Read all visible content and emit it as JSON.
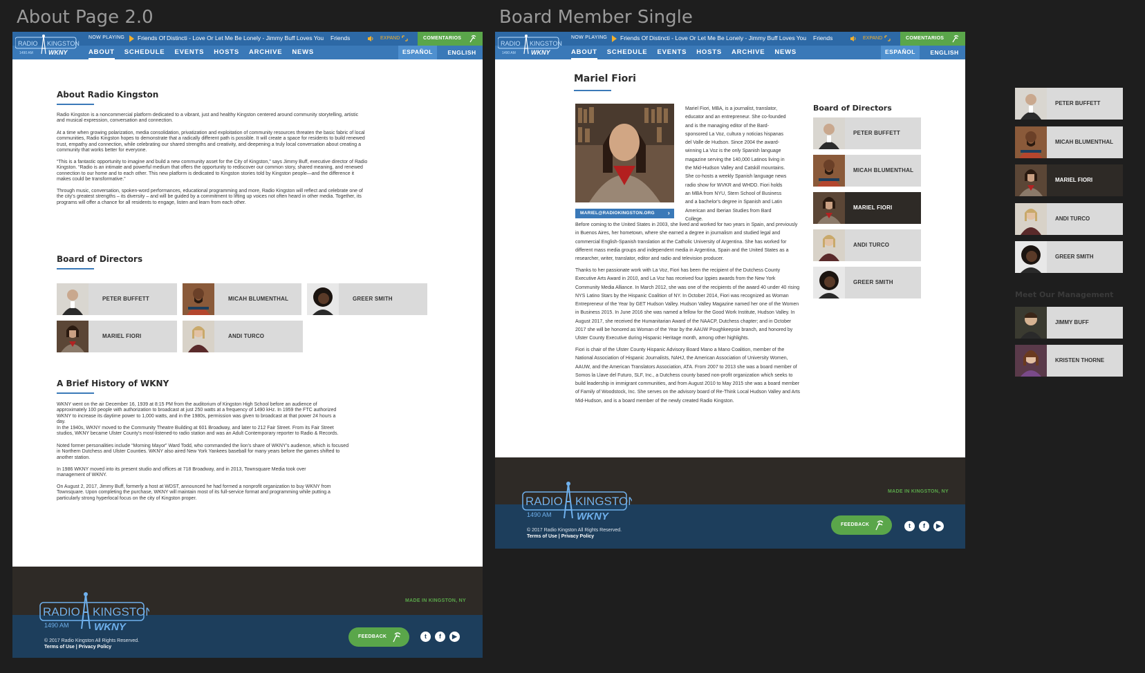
{
  "frames": {
    "about_title": "About Page 2.0",
    "single_title": "Board Member Single"
  },
  "header": {
    "now_playing_label": "NOW PLAYING",
    "track": "Friends Of Distincti - Love Or Let Me Be Lonely - Jimmy Buff Loves You",
    "track_extra": "Friends",
    "expand_label": "EXPAND",
    "comentarios_label": "COMENTARIOS",
    "nav": [
      "ABOUT",
      "SCHEDULE",
      "EVENTS",
      "HOSTS",
      "ARCHIVE",
      "NEWS"
    ],
    "lang_es": "ESPAÑOL",
    "lang_en": "ENGLISH",
    "logo_text": "RADIO KINGSTON",
    "logo_freq": "1490 AM",
    "logo_call": "WKNY"
  },
  "about": {
    "title": "About Radio Kingston",
    "paragraphs": [
      "Radio Kingston is a noncommercial platform dedicated to a vibrant, just and healthy Kingston centered around community storytelling, artistic and musical expression, conversation and connection.",
      "At a time when growing polarization, media consolidation, privatization and exploitation of community resources threaten the basic fabric of local communities, Radio Kingston hopes to demonstrate that a radically different path is possible. It will create a space for residents to build renewed trust, empathy and connection, while celebrating our shared strengths and creativity, and deepening a truly local conversation about creating a community that works better for everyone.",
      "“This is a fantastic opportunity to imagine and build a new community asset for the City of Kingston,” says Jimmy Buff, executive director of Radio Kingston. “Radio is an intimate and powerful medium that offers the opportunity to rediscover our common story, shared meaning, and renewed connection to our home and to each other. This new platform is dedicated to Kingston stories told by Kingston people—and the difference it makes could be transformative.”",
      "Through music, conversation, spoken-word performances, educational programming and more, Radio Kingston will reflect and celebrate one of the city's greatest strengths – its diversity – and will be guided by a commitment to lifting up voices not often heard in other media. Together, its programs will offer a chance for all residents to engage, listen and learn from each other."
    ],
    "board_title": "Board of Directors",
    "board": [
      "PETER BUFFETT",
      "MICAH BLUMENTHAL",
      "GREER SMITH",
      "MARIEL FIORI",
      "ANDI TURCO"
    ],
    "history_title": "A Brief History of WKNY",
    "history": [
      "WKNY went on the air December 16, 1939 at 8:15 PM from the auditorium of Kingston High School before an audience of approximately 100 people with authorization to broadcast at just 250 watts at a frequency of 1490 kHz. In 1959 the FTC authorized WKNY to increase its daytime power to 1,000 watts, and in the 1980s, permission was given to broadcast at that power 24 hours a day.",
      "In the 1940s, WKNY moved to the Community Theatre Building at 601 Broadway, and later to 212 Fair Street. From its Fair Street studios, WKNY became Ulster County's most-listened-to radio station and was an Adult Contemporary reporter to Radio & Records.",
      "Noted former personalities include “Morning Mayor” Ward Todd, who commanded the lion's share of WKNY's audience, which is focused in Northern Dutchess and Ulster Counties. WKNY also aired New York Yankees baseball for many years before the games shifted to another station.",
      "In 1986 WKNY moved into its present studio and offices at 718 Broadway, and in 2013, Townsquare Media took over management of WKNY.",
      "On August 2, 2017, Jimmy Buff, formerly a host at WDST, announced he had formed a nonprofit organization to buy WKNY from Townsquare. Upon completing the purchase, WKNY will maintain most of its full-service format and programming while putting a particularly strong hyperlocal focus on the city of Kingston proper."
    ]
  },
  "single": {
    "name": "Mariel Fiori",
    "email": "MARIEL@RADIOKINGSTON.ORG",
    "bio_side": "Mariel Fiori, MBA, is a journalist, translator, educator and an entrepreneur. She co-founded and is the managing editor of the Bard-sponsored La Voz, cultura y noticias hispanas del Valle de Hudson. Since 2004 the award-winning La Voz is the only Spanish language magazine serving the 140,000 Latinos living in the Mid-Hudson Valley and Catskill mountains. She co-hosts a weekly Spanish language news radio show for WVKR and WHDD. Fiori holds an MBA from NYU, Stern School of Business and a bachelor's degree in Spanish and Latin American and Iberian Studies from Bard College.",
    "bio": [
      "Before coming to the United States in 2003, she lived and worked for two years in Spain, and previously in Buenos Aires, her hometown, where she earned a degree in journalism and studied legal and commercial English-Spanish translation at the Catholic University of Argentina. She has worked for different mass media groups and independent media in Argentina, Spain and the United States as a researcher, writer, translator, editor and radio and television producer.",
      "Thanks to her passionate work with La Voz, Fiori has been the recipient of the Dutchess County Executive Arts Award in 2010, and La Voz has received four Ippies awards from the New York Community Media Alliance. In March 2012, she was one of the recipients of the award 40 under 40 rising NYS Latino Stars by the Hispanic Coalition of NY. In October 2014, Fiori was recognized as Woman Entrepreneur of the Year by GET Hudson Valley. Hudson Valley Magazine named her one of the Women in Business 2015. In June 2016 she was named a fellow for the Good Work Institute, Hudson Valley. In August 2017, she received the Humanitarian Award of the NAACP, Dutchess chapter; and in October 2017 she will be honored as Woman of the Year by the AAUW Poughkeepsie branch, and honored by Ulster County Executive during Hispanic Heritage month, among other highlights.",
      "Fiori is chair of the Ulster County Hispanic Advisory Board Mano a Mano Coalition, member of the National Association of Hispanic Journalists, NAHJ, the American Association of University Women, AAUW, and the American Translators Association, ATA. From 2007 to 2013 she was a board member of Somos la Llave del Futuro, SLF, Inc., a Dutchess county based non-profit organization which seeks to build leadership in immigrant communities, and from August 2010 to May 2015 she was a board member of Family of Woodstock, Inc. She serves on the advisory board of Re-Think Local Hudson Valley and Arts Mid-Hudson, and is a board member of the newly created Radio Kingston."
    ],
    "board_title": "Board of Directors",
    "board": [
      "PETER BUFFETT",
      "MICAH BLUMENTHAL",
      "MARIEL FIORI",
      "ANDI TURCO",
      "GREER SMITH"
    ]
  },
  "right_panel": {
    "board": [
      "PETER BUFFETT",
      "MICAH BLUMENTHAL",
      "MARIEL FIORI",
      "ANDI TURCO",
      "GREER SMITH"
    ],
    "mgmt_title": "Meet Our Management",
    "mgmt": [
      "JIMMY BUFF",
      "KRISTEN THORNE"
    ]
  },
  "footer": {
    "made_in": "MADE IN KINGSTON, NY",
    "copyright": "© 2017 Radio Kingston All Rights Reserved.",
    "terms": "Terms of Use",
    "sep": " | ",
    "privacy": "Privacy Policy",
    "feedback": "FEEDBACK",
    "social": [
      "twitter-icon",
      "facebook-icon",
      "youtube-icon"
    ]
  },
  "colors": {
    "brand_blue": "#3a79b8",
    "dark_blue": "#1d3e5c",
    "green": "#5aa64a",
    "dark": "#2e2a26",
    "card": "#dadada"
  }
}
